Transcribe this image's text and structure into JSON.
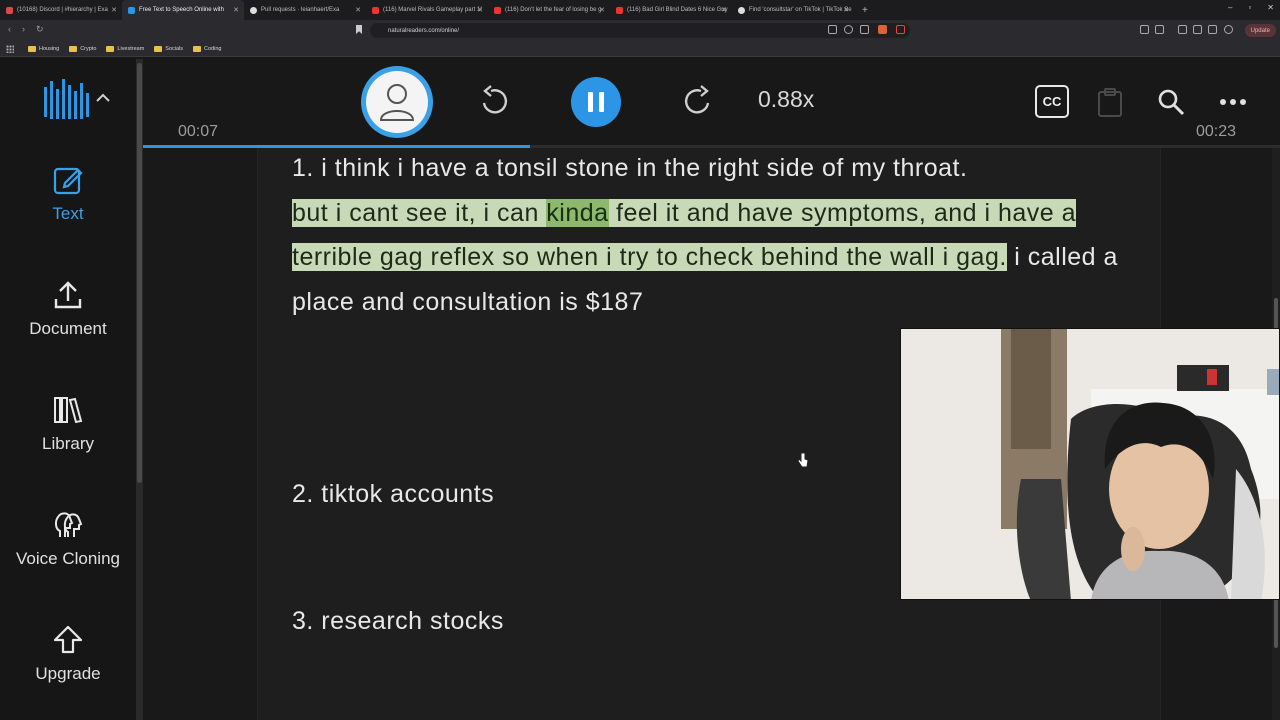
{
  "browser": {
    "tabs": [
      {
        "title": "(10168) Discord | #hierarchy | Exa",
        "color": "#d84a4a"
      },
      {
        "title": "Free Text to Speech Online with",
        "color": "#2d95e6",
        "active": true
      },
      {
        "title": "Pull requests · leianhaert/Exa",
        "color": "#dddddd"
      },
      {
        "title": "(116) Marvel Rivals Gameplay part 1!",
        "color": "#e33"
      },
      {
        "title": "(116) Don't let the fear of losing be g",
        "color": "#e33"
      },
      {
        "title": "(116) Bad Girl Blind Dates 6 Nice Guy",
        "color": "#e33"
      },
      {
        "title": "Find 'consultstar' on TikTok | TikTok Se",
        "color": "#dddddd"
      }
    ],
    "url": "naturalreaders.com/online/",
    "update_label": "Update",
    "bookmarks": [
      "Housing",
      "Crypto",
      "Livestream",
      "Socials",
      "Coding"
    ]
  },
  "sidebar": {
    "items": [
      {
        "label": "Text",
        "icon": "edit-icon"
      },
      {
        "label": "Document",
        "icon": "upload-icon"
      },
      {
        "label": "Library",
        "icon": "library-icon"
      },
      {
        "label": "Voice Cloning",
        "icon": "voice-cloning-icon"
      },
      {
        "label": "Upgrade",
        "icon": "upgrade-icon"
      }
    ]
  },
  "player": {
    "speed": "0.88x",
    "elapsed": "00:07",
    "total": "00:23",
    "progress": 0.34,
    "cc_label": "CC"
  },
  "document": {
    "p1_before": "1. i think i have a tonsil stone in the right side of my throat.",
    "p1_hl_a": "but i cant see it, i can ",
    "p1_hl_word": "kinda",
    "p1_hl_b": " feel it and have symptoms, and i have a terrible gag reflex so when i try to check behind the wall i gag.",
    "p1_after": " i called a place and consultation is $187",
    "p2": "2. tiktok accounts",
    "p3": "3. research stocks"
  },
  "colors": {
    "accent": "#2d95e6",
    "highlight": "#c8d9b8",
    "current_word": "#8db86e"
  }
}
